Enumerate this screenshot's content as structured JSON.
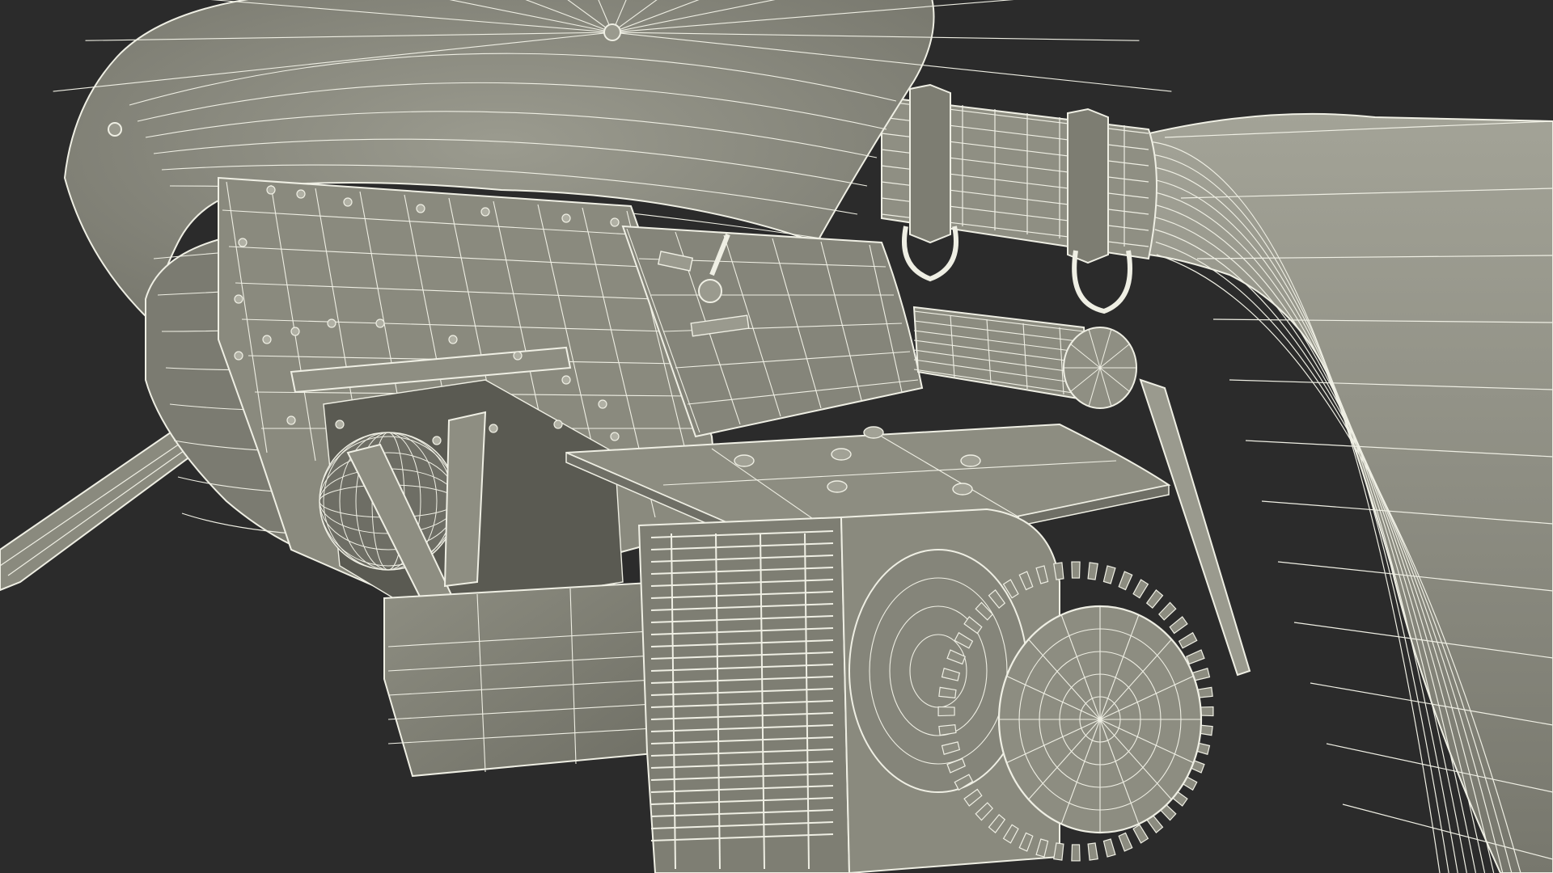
{
  "scene": {
    "subject": "3d-wireframe-render",
    "colors": {
      "background": "#2b2b2b",
      "shell": "#8b8b7f",
      "shell_dark": "#6f6f65",
      "shell_light": "#a2a296",
      "wire": "#efefe4",
      "cavity": "#55554d"
    }
  }
}
